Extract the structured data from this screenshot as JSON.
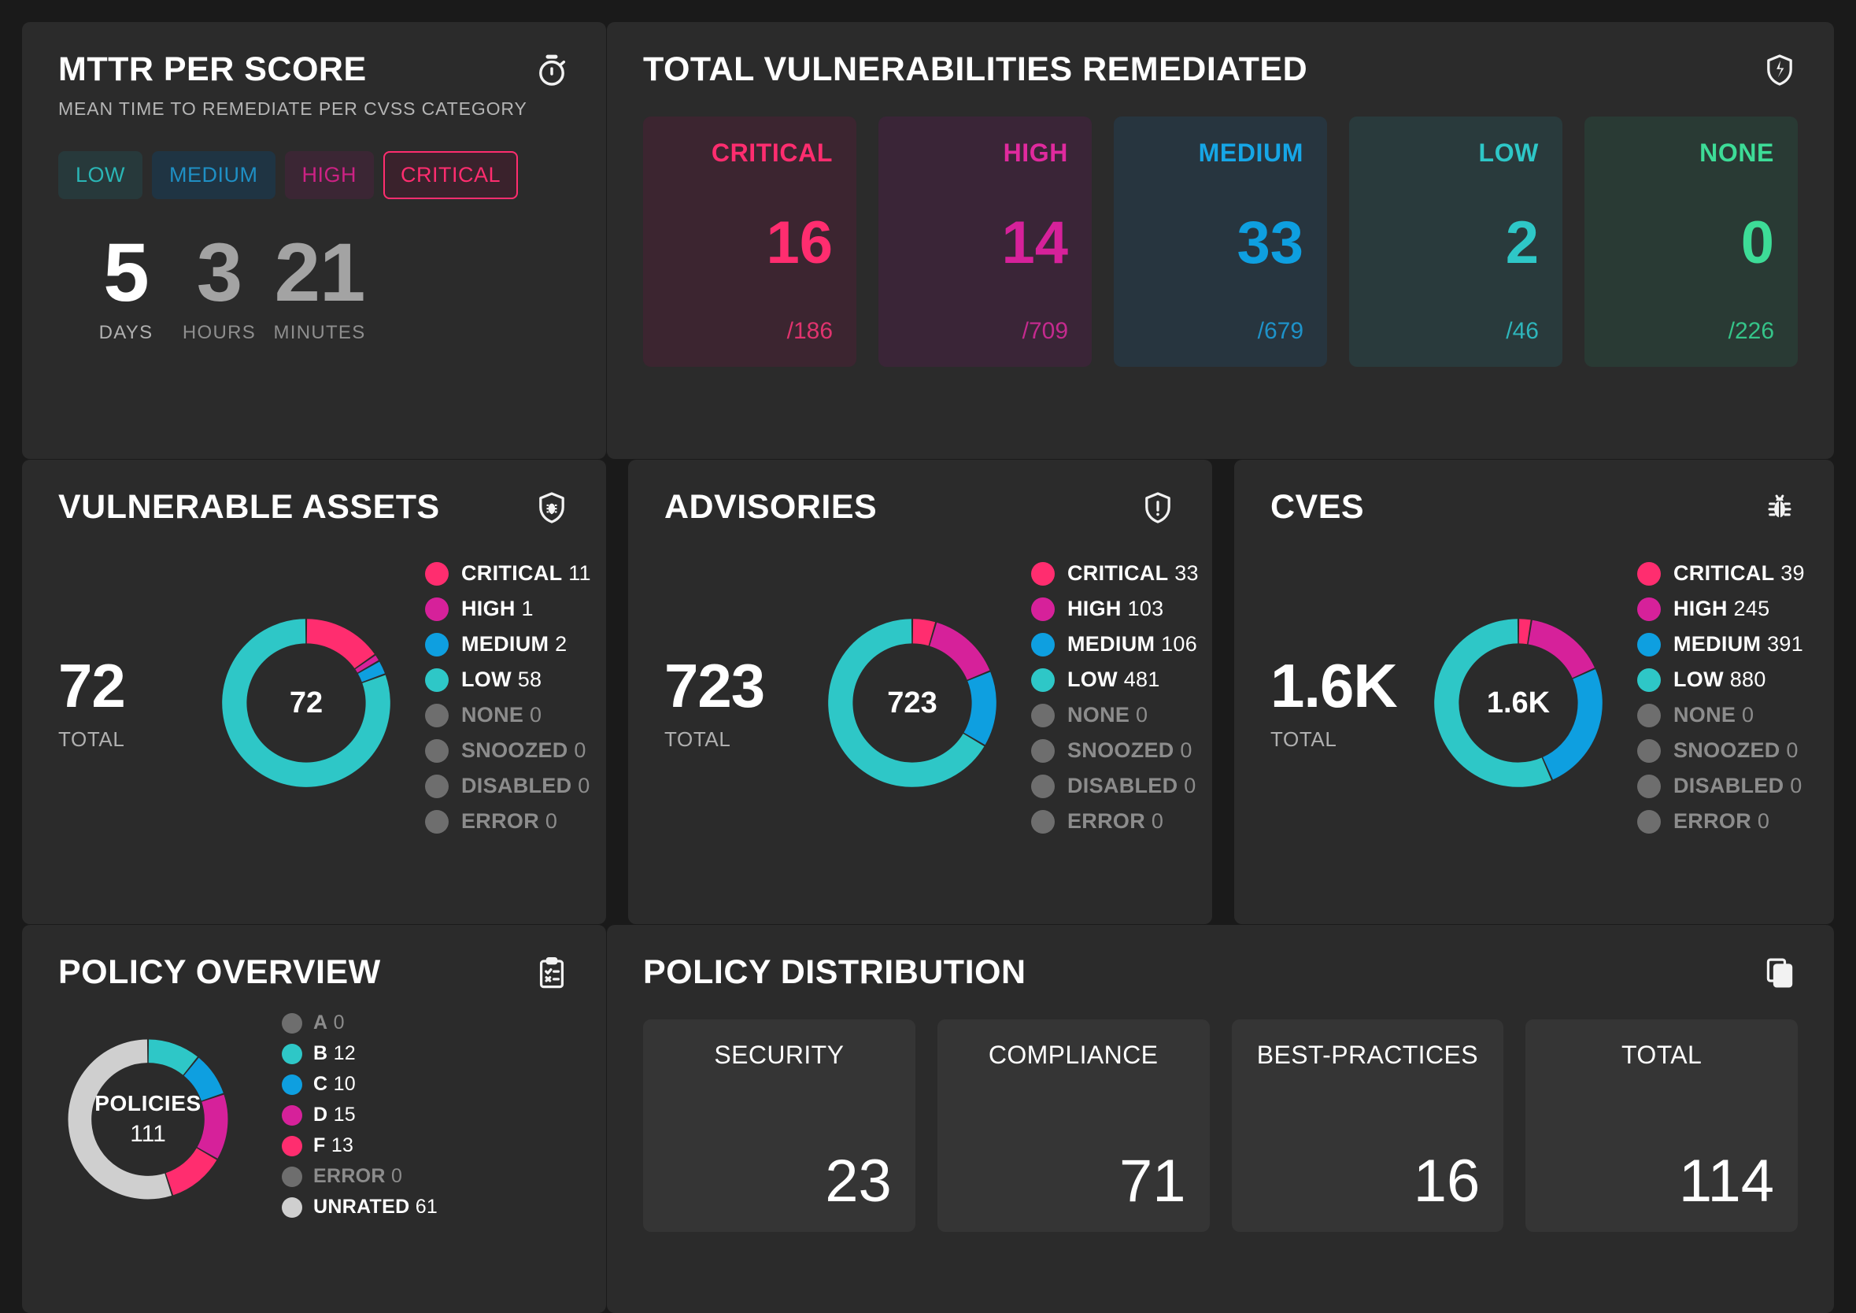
{
  "mttr": {
    "title": "MTTR PER SCORE",
    "subtitle": "MEAN TIME TO REMEDIATE PER CVSS CATEGORY",
    "icon": "stopwatch-icon",
    "pills": [
      {
        "label": "LOW",
        "key": "low",
        "selected": false
      },
      {
        "label": "MEDIUM",
        "key": "medium",
        "selected": false
      },
      {
        "label": "HIGH",
        "key": "high",
        "selected": false
      },
      {
        "label": "CRITICAL",
        "key": "critical",
        "selected": true
      }
    ],
    "timer": [
      {
        "value": "5",
        "unit": "DAYS",
        "primary": true
      },
      {
        "value": "3",
        "unit": "HOURS",
        "primary": false
      },
      {
        "value": "21",
        "unit": "MINUTES",
        "primary": false
      }
    ]
  },
  "remediated": {
    "title": "TOTAL VULNERABILITIES REMEDIATED",
    "icon": "broken-shield-icon",
    "cards": [
      {
        "label": "CRITICAL",
        "value": "16",
        "denominator": "/186",
        "color": "#ff2d6f",
        "bg": "#3c2530"
      },
      {
        "label": "HIGH",
        "value": "14",
        "denominator": "/709",
        "color": "#d6219a",
        "bg": "#3a2537"
      },
      {
        "label": "MEDIUM",
        "value": "33",
        "denominator": "/679",
        "color": "#0e9fe0",
        "bg": "#27353f"
      },
      {
        "label": "LOW",
        "value": "2",
        "denominator": "/46",
        "color": "#2ec7c7",
        "bg": "#293a3c"
      },
      {
        "label": "NONE",
        "value": "0",
        "denominator": "/226",
        "color": "#3ddc97",
        "bg": "#293a34"
      }
    ]
  },
  "vulnerable_assets": {
    "title": "VULNERABLE ASSETS",
    "icon": "shield-bug-icon",
    "total": "72",
    "total_label": "TOTAL",
    "center": "72",
    "legend": [
      {
        "label": "CRITICAL",
        "value": "11",
        "color": "#ff2d6f",
        "zero": false
      },
      {
        "label": "HIGH",
        "value": "1",
        "color": "#d6219a",
        "zero": false
      },
      {
        "label": "MEDIUM",
        "value": "2",
        "color": "#0e9fe0",
        "zero": false
      },
      {
        "label": "LOW",
        "value": "58",
        "color": "#2ec7c7",
        "zero": false
      },
      {
        "label": "NONE",
        "value": "0",
        "color": "#6e6e6e",
        "zero": true
      },
      {
        "label": "SNOOZED",
        "value": "0",
        "color": "#6e6e6e",
        "zero": true
      },
      {
        "label": "DISABLED",
        "value": "0",
        "color": "#6e6e6e",
        "zero": true
      },
      {
        "label": "ERROR",
        "value": "0",
        "color": "#6e6e6e",
        "zero": true
      }
    ]
  },
  "advisories": {
    "title": "ADVISORIES",
    "icon": "shield-alert-icon",
    "total": "723",
    "total_label": "TOTAL",
    "center": "723",
    "legend": [
      {
        "label": "CRITICAL",
        "value": "33",
        "color": "#ff2d6f",
        "zero": false
      },
      {
        "label": "HIGH",
        "value": "103",
        "color": "#d6219a",
        "zero": false
      },
      {
        "label": "MEDIUM",
        "value": "106",
        "color": "#0e9fe0",
        "zero": false
      },
      {
        "label": "LOW",
        "value": "481",
        "color": "#2ec7c7",
        "zero": false
      },
      {
        "label": "NONE",
        "value": "0",
        "color": "#6e6e6e",
        "zero": true
      },
      {
        "label": "SNOOZED",
        "value": "0",
        "color": "#6e6e6e",
        "zero": true
      },
      {
        "label": "DISABLED",
        "value": "0",
        "color": "#6e6e6e",
        "zero": true
      },
      {
        "label": "ERROR",
        "value": "0",
        "color": "#6e6e6e",
        "zero": true
      }
    ]
  },
  "cves": {
    "title": "CVES",
    "icon": "bug-icon",
    "total": "1.6K",
    "total_label": "TOTAL",
    "center": "1.6K",
    "legend": [
      {
        "label": "CRITICAL",
        "value": "39",
        "color": "#ff2d6f",
        "zero": false
      },
      {
        "label": "HIGH",
        "value": "245",
        "color": "#d6219a",
        "zero": false
      },
      {
        "label": "MEDIUM",
        "value": "391",
        "color": "#0e9fe0",
        "zero": false
      },
      {
        "label": "LOW",
        "value": "880",
        "color": "#2ec7c7",
        "zero": false
      },
      {
        "label": "NONE",
        "value": "0",
        "color": "#6e6e6e",
        "zero": true
      },
      {
        "label": "SNOOZED",
        "value": "0",
        "color": "#6e6e6e",
        "zero": true
      },
      {
        "label": "DISABLED",
        "value": "0",
        "color": "#6e6e6e",
        "zero": true
      },
      {
        "label": "ERROR",
        "value": "0",
        "color": "#6e6e6e",
        "zero": true
      }
    ]
  },
  "policy_overview": {
    "title": "POLICY OVERVIEW",
    "icon": "clipboard-check-icon",
    "center_label": "POLICIES",
    "center_value": "111",
    "legend": [
      {
        "label": "A",
        "value": "0",
        "color": "#6e6e6e",
        "zero": true
      },
      {
        "label": "B",
        "value": "12",
        "color": "#2ec7c7",
        "zero": false
      },
      {
        "label": "C",
        "value": "10",
        "color": "#0e9fe0",
        "zero": false
      },
      {
        "label": "D",
        "value": "15",
        "color": "#d6219a",
        "zero": false
      },
      {
        "label": "F",
        "value": "13",
        "color": "#ff2d6f",
        "zero": false
      },
      {
        "label": "ERROR",
        "value": "0",
        "color": "#6e6e6e",
        "zero": true
      },
      {
        "label": "UNRATED",
        "value": "61",
        "color": "#cfcfcf",
        "zero": false
      }
    ]
  },
  "policy_distribution": {
    "title": "POLICY DISTRIBUTION",
    "icon": "copy-icon",
    "cards": [
      {
        "label": "SECURITY",
        "value": "23"
      },
      {
        "label": "COMPLIANCE",
        "value": "71"
      },
      {
        "label": "BEST-PRACTICES",
        "value": "16"
      },
      {
        "label": "TOTAL",
        "value": "114"
      }
    ]
  },
  "chart_data": [
    {
      "type": "pie",
      "title": "VULNERABLE ASSETS",
      "categories": [
        "CRITICAL",
        "HIGH",
        "MEDIUM",
        "LOW",
        "NONE",
        "SNOOZED",
        "DISABLED",
        "ERROR"
      ],
      "values": [
        11,
        1,
        2,
        58,
        0,
        0,
        0,
        0
      ],
      "colors": [
        "#ff2d6f",
        "#d6219a",
        "#0e9fe0",
        "#2ec7c7",
        "#6e6e6e",
        "#6e6e6e",
        "#6e6e6e",
        "#6e6e6e"
      ],
      "total": 72,
      "legend": "right"
    },
    {
      "type": "pie",
      "title": "ADVISORIES",
      "categories": [
        "CRITICAL",
        "HIGH",
        "MEDIUM",
        "LOW",
        "NONE",
        "SNOOZED",
        "DISABLED",
        "ERROR"
      ],
      "values": [
        33,
        103,
        106,
        481,
        0,
        0,
        0,
        0
      ],
      "colors": [
        "#ff2d6f",
        "#d6219a",
        "#0e9fe0",
        "#2ec7c7",
        "#6e6e6e",
        "#6e6e6e",
        "#6e6e6e",
        "#6e6e6e"
      ],
      "total": 723,
      "legend": "right"
    },
    {
      "type": "pie",
      "title": "CVES",
      "categories": [
        "CRITICAL",
        "HIGH",
        "MEDIUM",
        "LOW",
        "NONE",
        "SNOOZED",
        "DISABLED",
        "ERROR"
      ],
      "values": [
        39,
        245,
        391,
        880,
        0,
        0,
        0,
        0
      ],
      "colors": [
        "#ff2d6f",
        "#d6219a",
        "#0e9fe0",
        "#2ec7c7",
        "#6e6e6e",
        "#6e6e6e",
        "#6e6e6e",
        "#6e6e6e"
      ],
      "total": 1555,
      "legend": "right"
    },
    {
      "type": "pie",
      "title": "POLICY OVERVIEW",
      "categories": [
        "A",
        "B",
        "C",
        "D",
        "F",
        "ERROR",
        "UNRATED"
      ],
      "values": [
        0,
        12,
        10,
        15,
        13,
        0,
        61
      ],
      "colors": [
        "#6e6e6e",
        "#2ec7c7",
        "#0e9fe0",
        "#d6219a",
        "#ff2d6f",
        "#6e6e6e",
        "#cfcfcf"
      ],
      "total": 111,
      "legend": "right"
    },
    {
      "type": "bar",
      "title": "POLICY DISTRIBUTION",
      "categories": [
        "SECURITY",
        "COMPLIANCE",
        "BEST-PRACTICES",
        "TOTAL"
      ],
      "values": [
        23,
        71,
        16,
        114
      ],
      "xlabel": "",
      "ylabel": ""
    },
    {
      "type": "bar",
      "title": "TOTAL VULNERABILITIES REMEDIATED",
      "categories": [
        "CRITICAL",
        "HIGH",
        "MEDIUM",
        "LOW",
        "NONE"
      ],
      "values": [
        16,
        14,
        33,
        2,
        0
      ],
      "totals": [
        186,
        709,
        679,
        46,
        226
      ],
      "colors": [
        "#ff2d6f",
        "#d6219a",
        "#0e9fe0",
        "#2ec7c7",
        "#3ddc97"
      ]
    }
  ]
}
